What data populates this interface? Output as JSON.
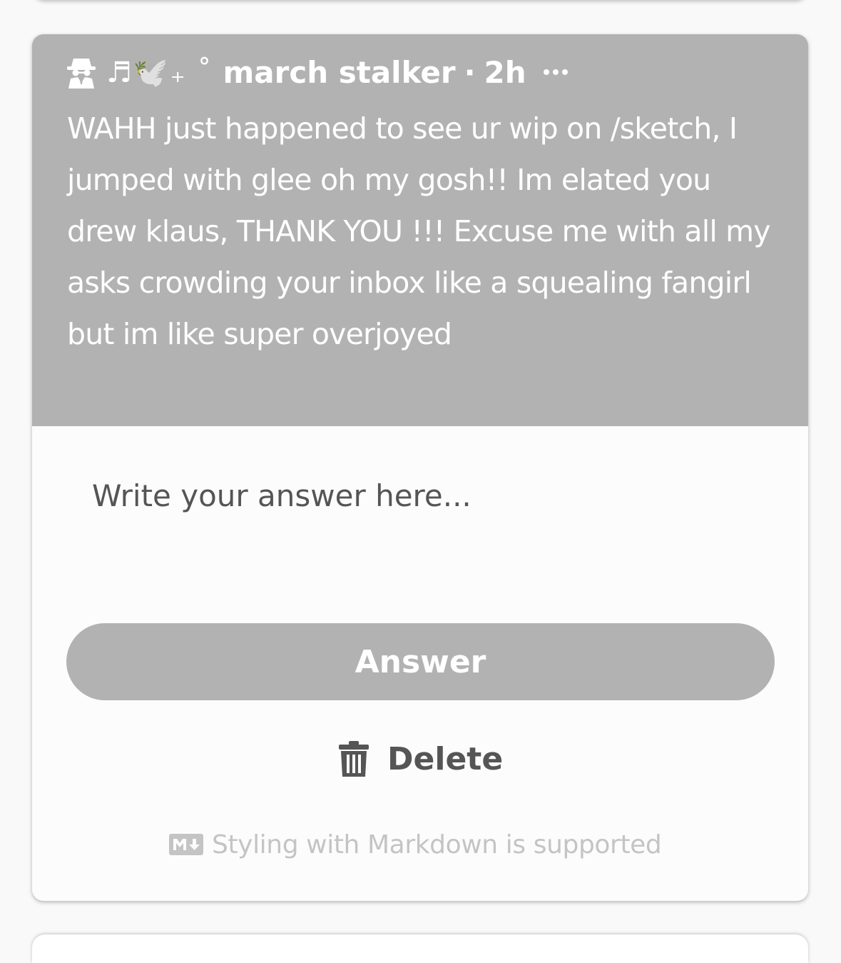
{
  "ask": {
    "asker_decor": "♬🕊️₊ ˚",
    "asker_name": "march stalker",
    "separator": "·",
    "time": "2h",
    "question": "WAHH just happened to see ur wip on /sketch, I jumped with glee oh my gosh!! Im elated you drew klaus, THANK YOU !!! Excuse me with all my asks crowding your inbox like a squealing fangirl but im like super overjoyed"
  },
  "answer": {
    "placeholder": "Write your answer here...",
    "answer_label": "Answer",
    "delete_label": "Delete",
    "markdown_note": "Styling with Markdown is supported"
  },
  "icons": {
    "asker": "anonymous-spy-icon",
    "more": "more-dots-icon",
    "delete": "trash-icon",
    "markdown": "markdown-icon"
  },
  "colors": {
    "question_bg": "#b2b2b2",
    "answer_button_bg": "#b2b2b2",
    "card_bg": "#fcfcfc",
    "delete_text": "#555555",
    "hint_text": "#c4c4c4"
  }
}
